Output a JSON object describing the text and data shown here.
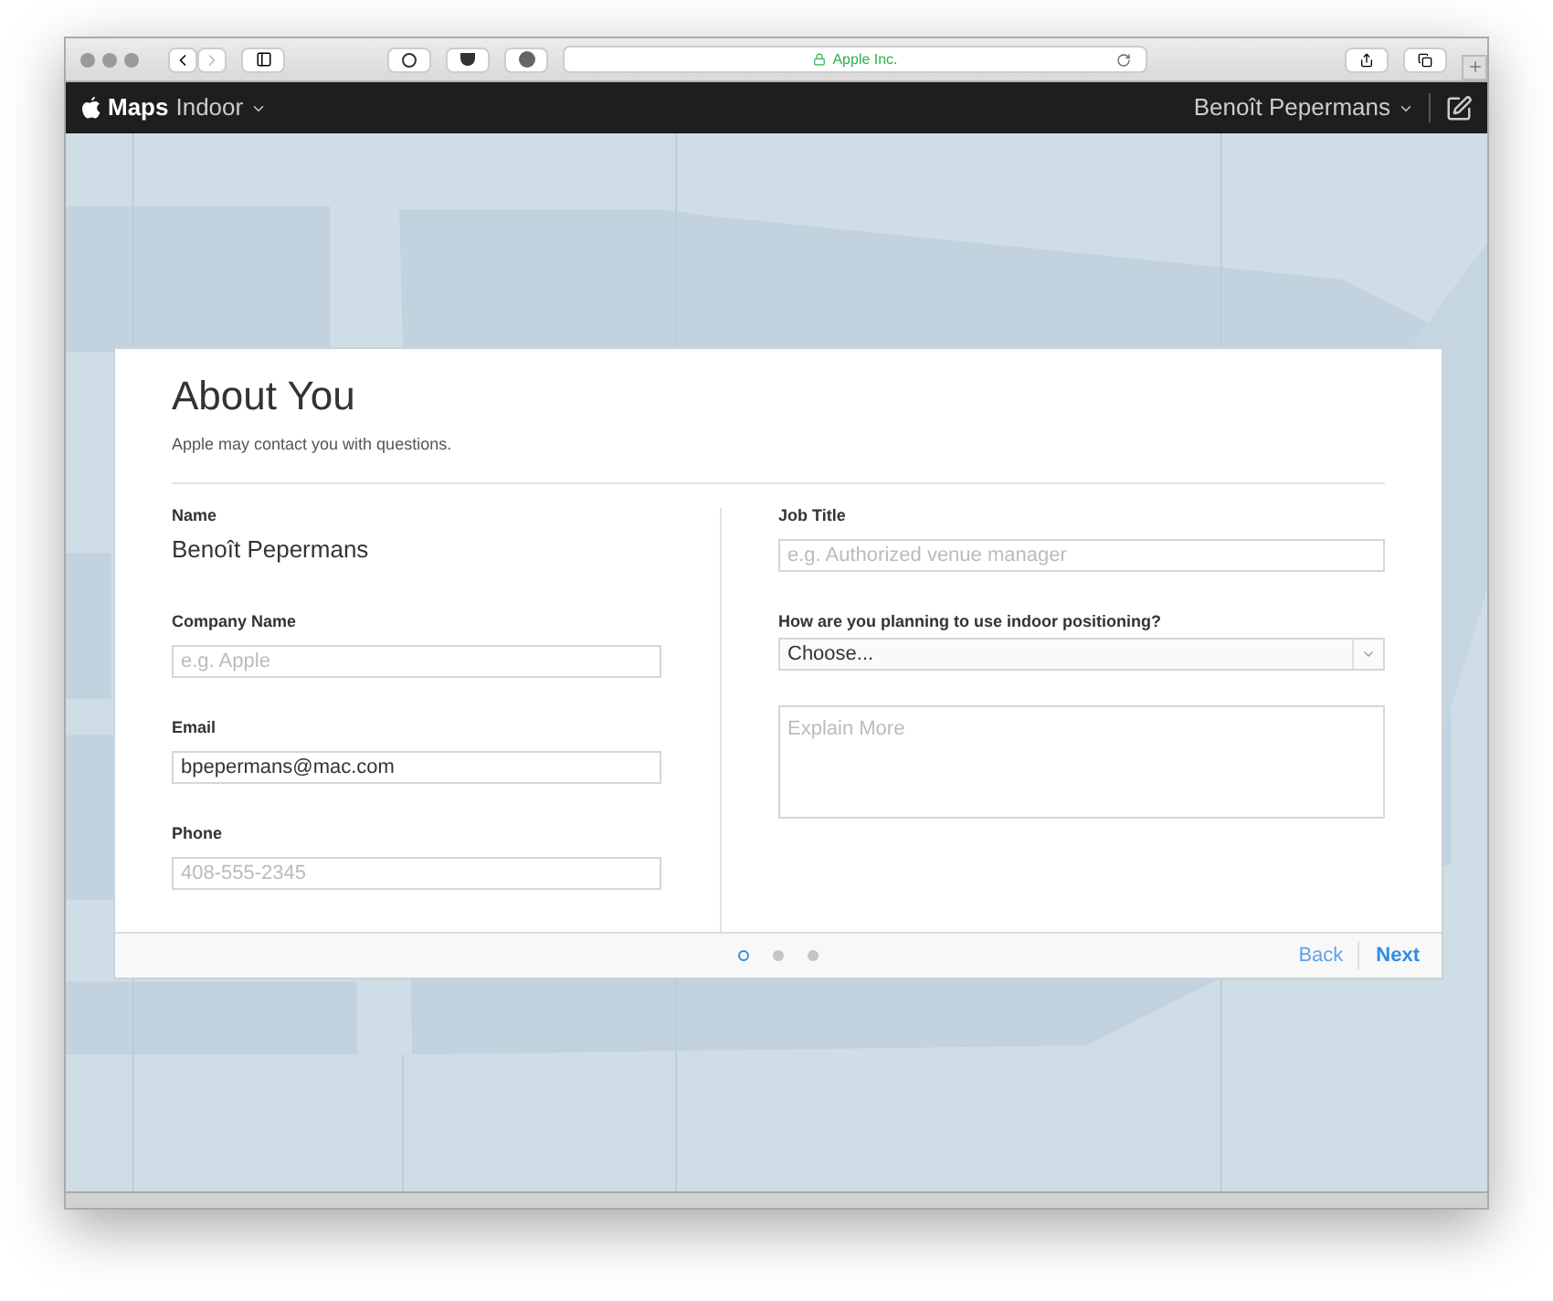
{
  "browser": {
    "address": "Apple Inc."
  },
  "navbar": {
    "app_name": "Maps",
    "app_section": "Indoor",
    "user": "Benoît Pepermans"
  },
  "dialog": {
    "title": "About You",
    "subtitle": "Apple may contact you with questions.",
    "left_fields": [
      {
        "kind": "static",
        "label": "Name",
        "value": "Benoît Pepermans"
      },
      {
        "kind": "input",
        "label": "Company Name",
        "placeholder": "e.g. Apple"
      },
      {
        "kind": "input",
        "label": "Email",
        "value": "bpepermans@mac.com"
      },
      {
        "kind": "input",
        "label": "Phone",
        "placeholder": "408-555-2345"
      }
    ],
    "right_fields": [
      {
        "kind": "input",
        "label": "Job Title",
        "placeholder": "e.g. Authorized venue manager"
      },
      {
        "kind": "select",
        "label": "How are you planning to use indoor positioning?",
        "value": "Choose..."
      },
      {
        "kind": "textarea",
        "placeholder": "Explain More"
      }
    ],
    "steps": [
      {
        "selected": true
      },
      {
        "selected": false
      },
      {
        "selected": false
      }
    ],
    "back": "Back",
    "next": "Next"
  }
}
